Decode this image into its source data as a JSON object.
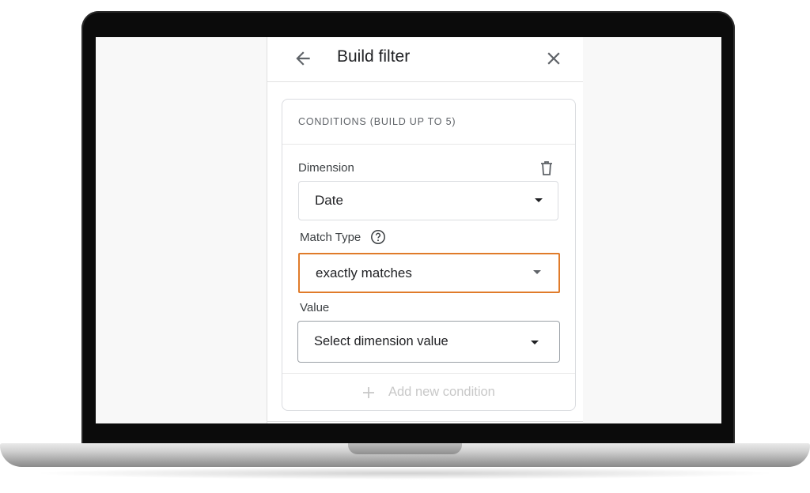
{
  "panel": {
    "title": "Build filter"
  },
  "conditions": {
    "header": "CONDITIONS (BUILD UP TO 5)",
    "dimension": {
      "label": "Dimension",
      "selected": "Date"
    },
    "match_type": {
      "label": "Match Type",
      "selected": "exactly matches"
    },
    "value": {
      "label": "Value",
      "placeholder": "Select dimension value"
    },
    "add_condition_label": "Add new condition"
  },
  "colors": {
    "highlight": "#e07b2a",
    "text_primary": "#202124",
    "disabled": "#c8c8c8"
  },
  "icons": [
    "arrow-back-icon",
    "close-icon",
    "trash-icon",
    "help-circle-icon",
    "chevron-down-icon",
    "plus-icon"
  ]
}
